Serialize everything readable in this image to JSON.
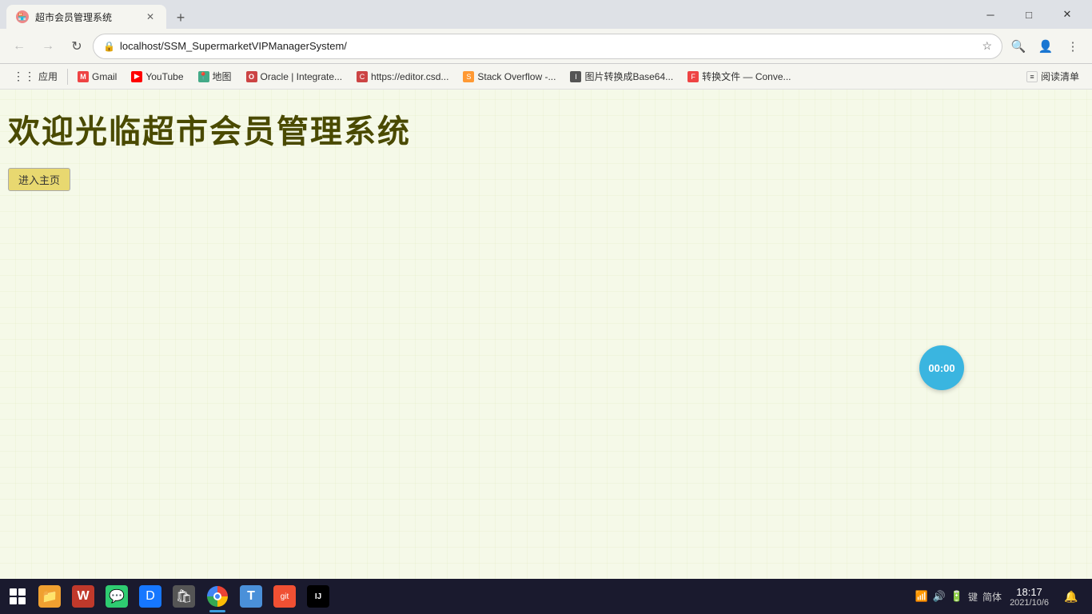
{
  "window": {
    "tab_title": "超市会员管理系统",
    "tab_favicon": "🏪",
    "url": "localhost/SSM_SupermarketVIPManagerSystem/",
    "close_label": "✕",
    "minimize_label": "─",
    "maximize_label": "□"
  },
  "toolbar": {
    "back_disabled": true,
    "forward_disabled": true,
    "lock_icon": "🔒",
    "star_icon": "☆",
    "search_icon": "🔍",
    "profile_icon": "👤",
    "menu_icon": "⋮"
  },
  "bookmarks": [
    {
      "id": "apps",
      "label": "应用",
      "icon": "⋮⋮⋮",
      "type": "apps"
    },
    {
      "id": "gmail",
      "label": "Gmail",
      "icon": "M",
      "color": "#e44"
    },
    {
      "id": "youtube",
      "label": "YouTube",
      "icon": "▶",
      "color": "#f00"
    },
    {
      "id": "maps",
      "label": "地图",
      "icon": "📍",
      "color": "#4a8"
    },
    {
      "id": "oracle",
      "label": "Oracle | Integrate...",
      "icon": "O",
      "color": "#c44"
    },
    {
      "id": "csdn",
      "label": "https://editor.csd...",
      "icon": "C",
      "color": "#c44"
    },
    {
      "id": "stackoverflow",
      "label": "Stack Overflow -...",
      "icon": "S",
      "color": "#f93"
    },
    {
      "id": "imgconvert",
      "label": "图片转换成Base64...",
      "icon": "I",
      "color": "#555"
    },
    {
      "id": "convert",
      "label": "转换文件 — Conve...",
      "icon": "F",
      "color": "#e44"
    },
    {
      "id": "reader",
      "label": "阅读清单",
      "icon": "≡",
      "color": "#333"
    }
  ],
  "page": {
    "title": "欢迎光临超市会员管理系统",
    "enter_button": "进入主页",
    "background_color": "#f5f9e8",
    "timer": "00:00"
  },
  "taskbar": {
    "icons": [
      {
        "id": "files",
        "label": "文件",
        "type": "files",
        "active": false
      },
      {
        "id": "wps",
        "label": "WPS",
        "type": "wps",
        "active": false
      },
      {
        "id": "wechat",
        "label": "微信",
        "type": "wechat",
        "active": false
      },
      {
        "id": "dingtalk",
        "label": "钉钉",
        "type": "dingtalk",
        "active": false
      },
      {
        "id": "store",
        "label": "应用商店",
        "type": "store",
        "active": false
      },
      {
        "id": "chrome",
        "label": "Chrome",
        "type": "chrome",
        "active": true
      },
      {
        "id": "typora",
        "label": "Typora",
        "type": "typora",
        "active": false
      },
      {
        "id": "git",
        "label": "Git",
        "type": "git",
        "active": false
      },
      {
        "id": "idea",
        "label": "IDEA",
        "type": "idea",
        "active": false
      }
    ],
    "tray": {
      "network": "📶",
      "sound": "🔊",
      "battery": "🔋",
      "keyboard": "键",
      "ime": "简体"
    },
    "time": "18:17",
    "date": "2021/10/6"
  }
}
